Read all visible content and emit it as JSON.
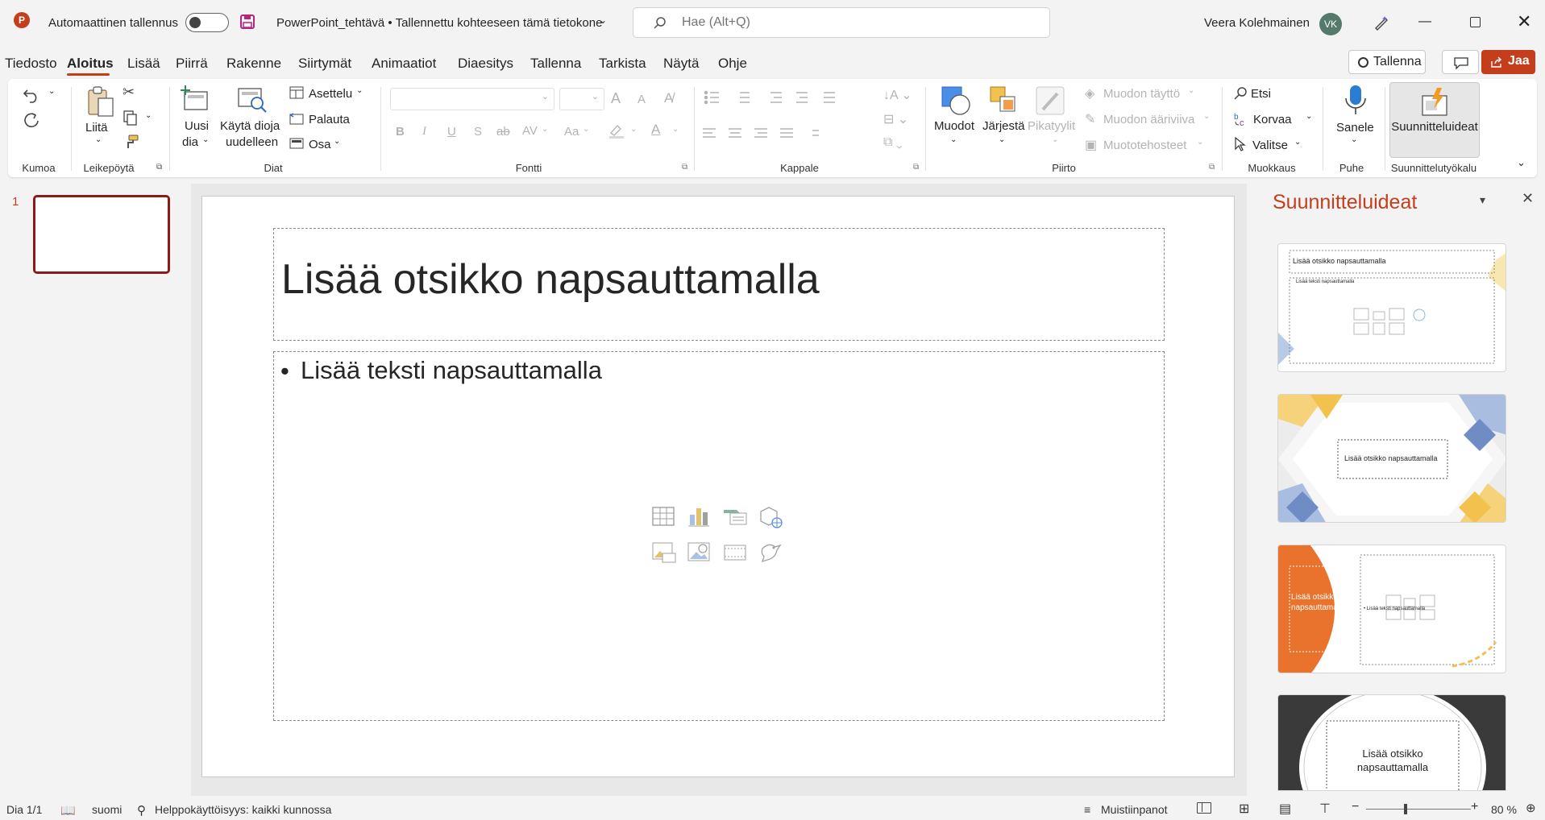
{
  "titlebar": {
    "autosave_label": "Automaattinen tallennus",
    "document_title": "PowerPoint_tehtävä • Tallennettu kohteeseen tämä tietokone",
    "search_placeholder": "Hae (Alt+Q)",
    "user_name": "Veera Kolehmainen",
    "user_initials": "VK"
  },
  "menu": {
    "tabs": [
      "Tiedosto",
      "Aloitus",
      "Lisää",
      "Piirrä",
      "Rakenne",
      "Siirtymät",
      "Animaatiot",
      "Diaesitys",
      "Tallenna",
      "Tarkista",
      "Näytä",
      "Ohje"
    ],
    "active_tab": "Aloitus",
    "record_button": "Tallenna",
    "share_button": "Jaa"
  },
  "ribbon": {
    "undo_group": "Kumoa",
    "clipboard": {
      "paste": "Liitä",
      "group": "Leikepöytä"
    },
    "slides": {
      "new_slide_1": "Uusi",
      "new_slide_2": "dia",
      "reuse_1": "Käytä dioja",
      "reuse_2": "uudelleen",
      "layout": "Asettelu",
      "reset": "Palauta",
      "section": "Osa",
      "group": "Diat"
    },
    "font": {
      "group": "Fontti",
      "bold": "B",
      "italic": "I",
      "underline": "U",
      "shadow": "S",
      "strike": "ab",
      "spacing": "AV",
      "case": "Aa",
      "grow": "A",
      "shrink": "A",
      "color": "A"
    },
    "paragraph": {
      "group": "Kappale"
    },
    "drawing": {
      "shapes": "Muodot",
      "arrange": "Järjestä",
      "quick_styles": "Pikatyylit",
      "fill": "Muodon täyttö",
      "outline": "Muodon ääriviiva",
      "effects": "Muototehosteet",
      "group": "Piirto"
    },
    "editing": {
      "find": "Etsi",
      "replace": "Korvaa",
      "select": "Valitse",
      "group": "Muokkaus"
    },
    "voice": {
      "dictate": "Sanele",
      "group": "Puhe"
    },
    "designer": {
      "button": "Suunnitteluideat",
      "group": "Suunnittelutyökalu"
    }
  },
  "thumbnails": {
    "slide_number": "1"
  },
  "slide": {
    "title_placeholder": "Lisää otsikko napsauttamalla",
    "body_placeholder": "Lisää teksti napsauttamalla"
  },
  "designer_pane": {
    "title": "Suunnitteluideat",
    "card1_title": "Lisää otsikko napsauttamalla",
    "card1_body": "Lisää teksti napsauttamalla",
    "card2_title": "Lisää otsikko napsauttamalla",
    "card3_title": "Lisää otsikko napsauttama lla",
    "card3_body": "• Lisää teksti napsauttamalla",
    "card4_title": "Lisää otsikko napsauttamalla"
  },
  "statusbar": {
    "slide_count": "Dia 1/1",
    "language": "suomi",
    "accessibility": "Helppokäyttöisyys: kaikki kunnossa",
    "notes": "Muistiinpanot",
    "zoom": "80 %"
  },
  "colors": {
    "accent": "#c43e1c",
    "share_bg": "#c43e1c",
    "selected_thumb": "#8b1b1b",
    "designer_title": "#c43e1c"
  }
}
